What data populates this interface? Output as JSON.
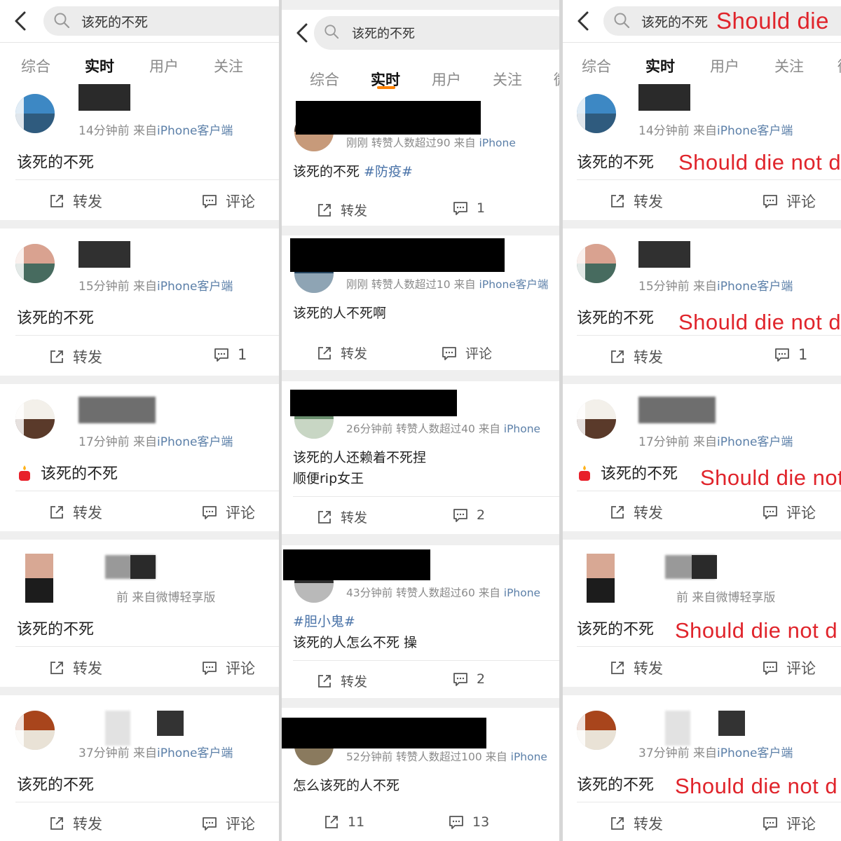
{
  "search_query": "该死的不死",
  "search_overlay_en": "Should die",
  "tabs": {
    "left": [
      "综合",
      "实时",
      "用户",
      "关注"
    ],
    "middle": [
      "综合",
      "实时",
      "用户",
      "关注",
      "微"
    ],
    "right": [
      "综合",
      "实时",
      "用户",
      "关注",
      "微"
    ]
  },
  "posts_left": [
    {
      "meta_time": "14分钟前",
      "meta_from": "来自",
      "meta_src": "iPhone客户端",
      "text": "该死的不死",
      "en": "Should die not d",
      "repost": "转发",
      "comment": "评论"
    },
    {
      "meta_time": "15分钟前",
      "meta_from": "来自",
      "meta_src": "iPhone客户端",
      "text": "该死的不死",
      "en": "Should die not d",
      "repost": "转发",
      "comment": "1"
    },
    {
      "meta_time": "17分钟前",
      "meta_from": "来自",
      "meta_src": "iPhone客户端",
      "text": "该死的不死",
      "en": "Should die not",
      "repost": "转发",
      "comment": "评论"
    },
    {
      "meta_time": "前",
      "meta_from": "来自",
      "meta_src": "微博轻享版",
      "text": "该死的不死",
      "en": "Should die not d",
      "repost": "转发",
      "comment": "评论"
    },
    {
      "meta_time": "37分钟前",
      "meta_from": "来自",
      "meta_src": "iPhone客户端",
      "text": "该死的不死",
      "en": "Should die not d",
      "repost": "转发",
      "comment": "评论"
    }
  ],
  "posts_middle": [
    {
      "meta": "刚刚 转赞人数超过90",
      "meta_from": "来自",
      "meta_src": "iPhone",
      "text": "该死的不死 ",
      "hashtag": "#防疫#",
      "line2": "",
      "repost": "转发",
      "comment": "1"
    },
    {
      "meta": "刚刚 转赞人数超过10",
      "meta_from": "来自",
      "meta_src": "iPhone客户端",
      "text": "该死的人不死啊",
      "hashtag": "",
      "line2": "",
      "repost": "转发",
      "comment": "评论"
    },
    {
      "meta": "26分钟前 转赞人数超过40",
      "meta_from": "来自",
      "meta_src": "iPhone",
      "text": "该死的人还赖着不死捏",
      "hashtag": "",
      "line2": "顺便rip女王",
      "repost": "转发",
      "comment": "2"
    },
    {
      "meta": "43分钟前 转赞人数超过60",
      "meta_from": "来自",
      "meta_src": "iPhone",
      "text": "",
      "hashtag": "#胆小鬼#",
      "line2": "该死的人怎么不死 操",
      "repost": "转发",
      "comment": "2"
    },
    {
      "meta": "52分钟前 转赞人数超过100",
      "meta_from": "来自",
      "meta_src": "iPhone",
      "text": "怎么该死的人不死",
      "hashtag": "",
      "line2": "",
      "repost": "11",
      "comment": "13"
    }
  ],
  "colors": {
    "accent": "#ff8200",
    "link": "#5b7fa8",
    "overlay_red": "#e0242b"
  },
  "icons": [
    "back-icon",
    "search-icon",
    "repost-icon",
    "comment-icon",
    "candle-icon"
  ]
}
